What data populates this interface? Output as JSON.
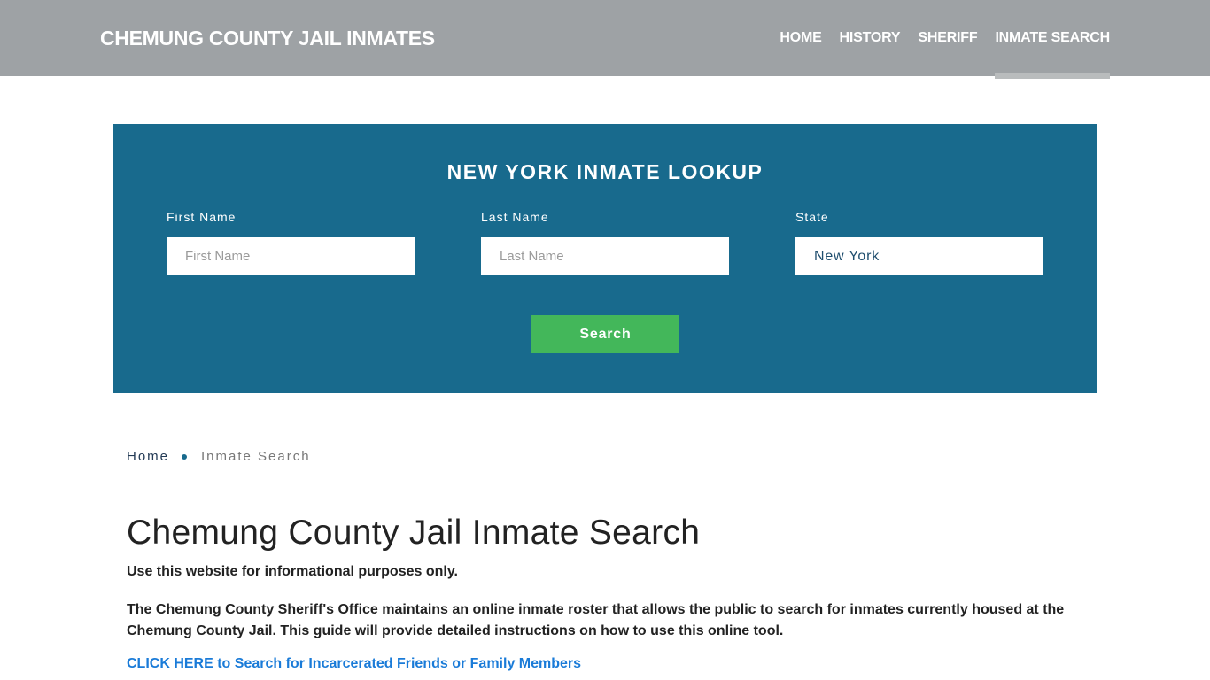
{
  "header": {
    "brand": "CHEMUNG COUNTY JAIL INMATES",
    "nav": [
      {
        "label": "HOME",
        "active": false
      },
      {
        "label": "HISTORY",
        "active": false
      },
      {
        "label": "SHERIFF",
        "active": false
      },
      {
        "label": "INMATE SEARCH",
        "active": true
      }
    ]
  },
  "lookup": {
    "title": "NEW YORK INMATE LOOKUP",
    "first_name": {
      "label": "First Name",
      "placeholder": "First Name",
      "value": ""
    },
    "last_name": {
      "label": "Last Name",
      "placeholder": "Last Name",
      "value": ""
    },
    "state": {
      "label": "State",
      "value": "New York"
    },
    "search_label": "Search"
  },
  "breadcrumb": {
    "home": "Home",
    "current": "Inmate Search"
  },
  "content": {
    "title": "Chemung County Jail Inmate Search",
    "intro": "Use this website for informational purposes only.",
    "description": "The Chemung County Sheriff's Office maintains an online inmate roster that allows the public to search for inmates currently housed at the Chemung County Jail. This guide will provide detailed instructions on how to use this online tool.",
    "cta": "CLICK HERE to Search for Incarcerated Friends or Family Members"
  },
  "colors": {
    "header_bg": "#9ea2a5",
    "lookup_bg": "#186a8d",
    "button_bg": "#43b75a",
    "link": "#1a7bd8"
  }
}
